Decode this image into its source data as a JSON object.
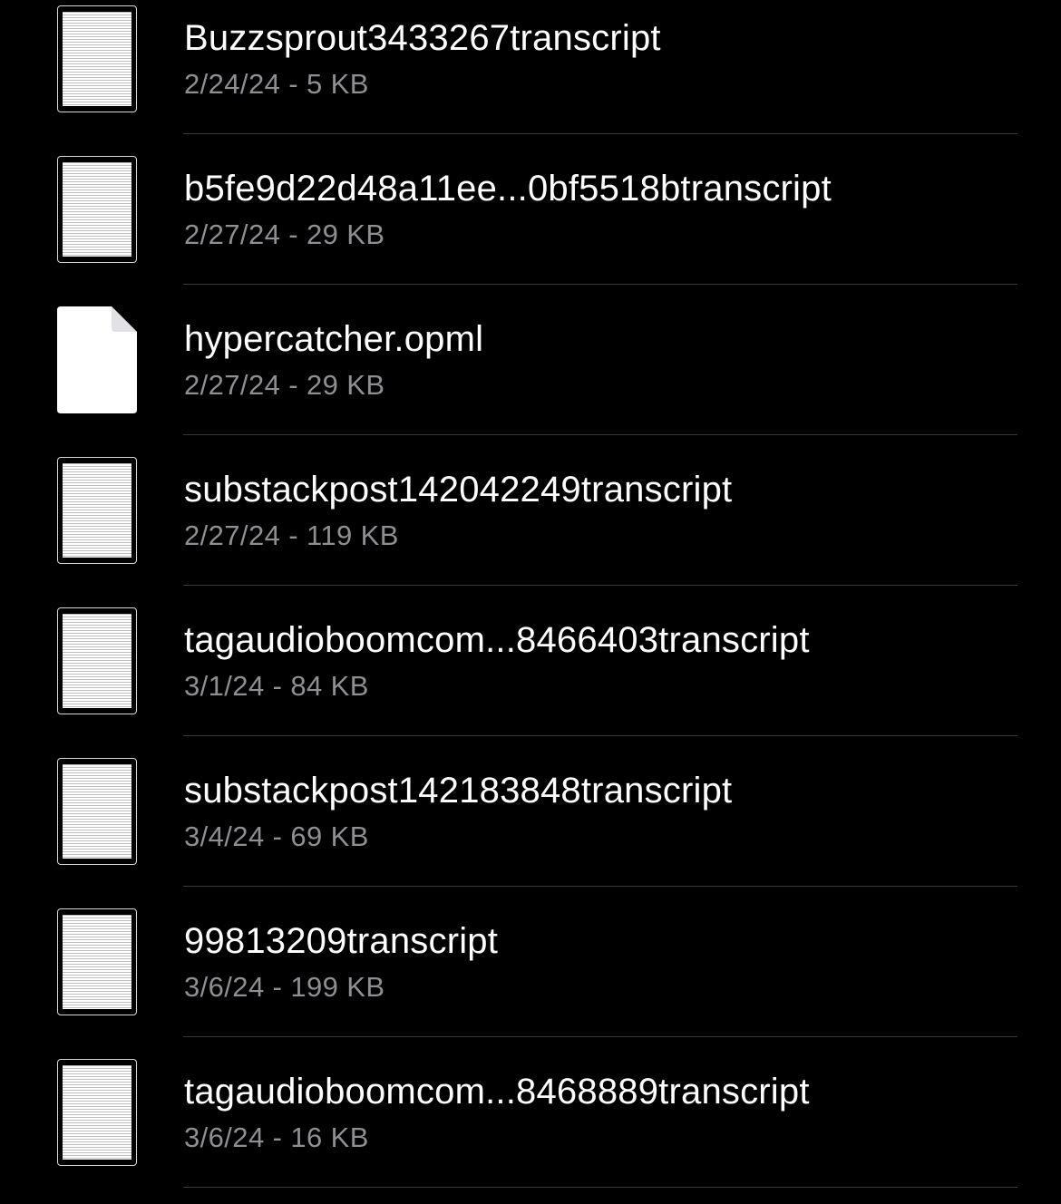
{
  "files": [
    {
      "name": "Buzzsprout3433267transcript",
      "meta": "2/24/24 - 5 KB",
      "icon": "text-document-thumbnail-icon"
    },
    {
      "name": "b5fe9d22d48a11ee...0bf5518btranscript",
      "meta": "2/27/24 - 29 KB",
      "icon": "text-document-thumbnail-icon"
    },
    {
      "name": "hypercatcher.opml",
      "meta": "2/27/24 - 29 KB",
      "icon": "blank-document-icon"
    },
    {
      "name": "substackpost142042249transcript",
      "meta": "2/27/24 - 119 KB",
      "icon": "text-document-thumbnail-icon"
    },
    {
      "name": "tagaudioboomcom...8466403transcript",
      "meta": "3/1/24 - 84 KB",
      "icon": "text-document-thumbnail-icon"
    },
    {
      "name": "substackpost142183848transcript",
      "meta": "3/4/24 - 69 KB",
      "icon": "text-document-thumbnail-icon"
    },
    {
      "name": "99813209transcript",
      "meta": "3/6/24 - 199 KB",
      "icon": "text-document-thumbnail-icon"
    },
    {
      "name": "tagaudioboomcom...8468889transcript",
      "meta": "3/6/24 - 16 KB",
      "icon": "text-document-thumbnail-icon"
    }
  ],
  "colors": {
    "background": "#000000",
    "primary_text": "#ffffff",
    "secondary_text": "#8e8e93",
    "divider": "#38383a"
  }
}
